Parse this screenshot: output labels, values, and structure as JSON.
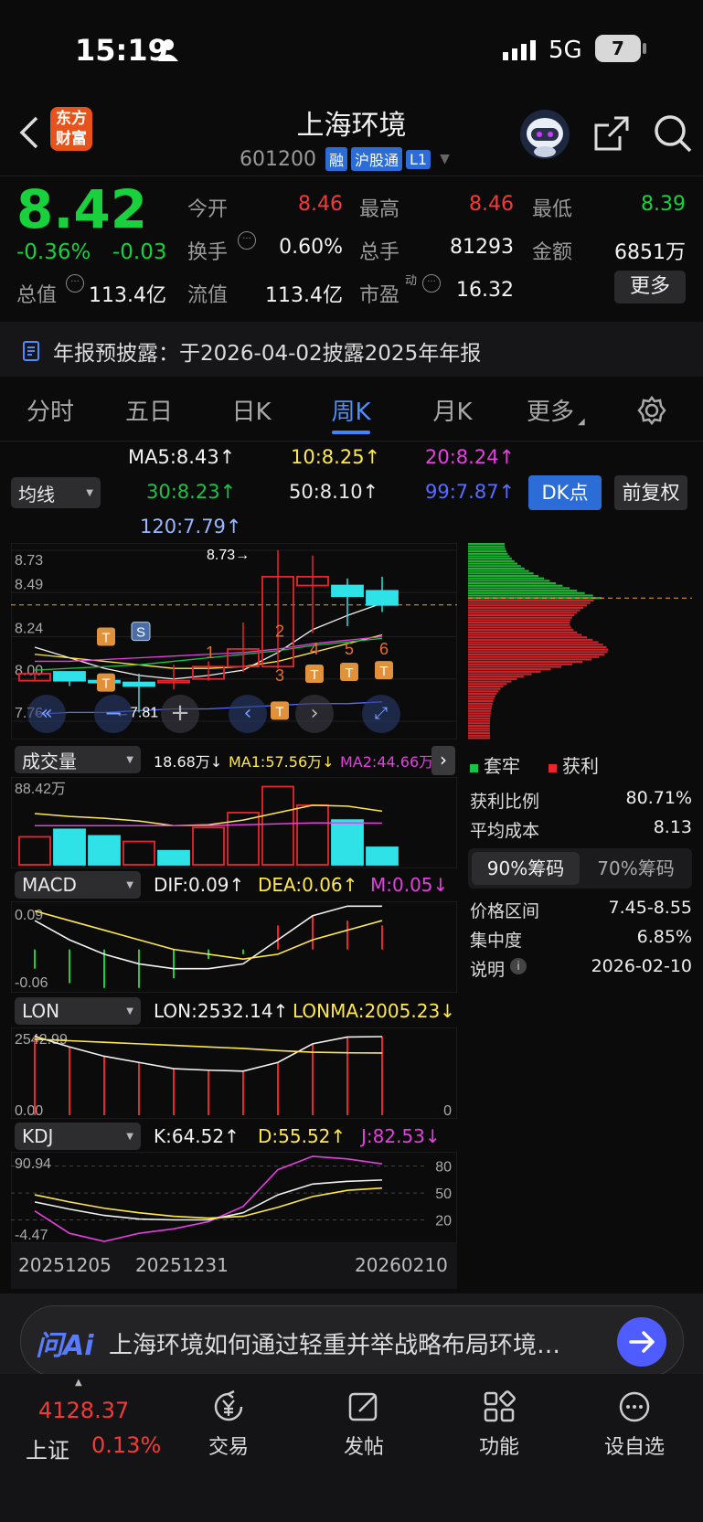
{
  "status_bar": {
    "time": "15:19",
    "network": "5G",
    "battery": "7"
  },
  "header": {
    "logo_text": "东方\n财富",
    "title": "上海环境",
    "code": "601200",
    "badges": [
      "融",
      "沪股通",
      "L1"
    ]
  },
  "quote": {
    "price": "8.42",
    "change_pct": "-0.36%",
    "change": "-0.03",
    "fields": [
      {
        "label": "今开",
        "value": "8.46",
        "color": "red"
      },
      {
        "label": "最高",
        "value": "8.46",
        "color": "red"
      },
      {
        "label": "最低",
        "value": "8.39",
        "color": "green"
      },
      {
        "label": "换手",
        "value": "0.60%",
        "color": "white"
      },
      {
        "label": "总手",
        "value": "81293",
        "color": "white"
      },
      {
        "label": "金额",
        "value": "6851万",
        "color": "white"
      },
      {
        "label": "总值",
        "value": "113.4亿",
        "color": "white"
      },
      {
        "label": "流值",
        "value": "113.4亿",
        "color": "white"
      },
      {
        "label": "市盈",
        "value": "16.32",
        "color": "white"
      }
    ],
    "dyn_sup": "动",
    "more_button": "更多"
  },
  "notice": {
    "text": "年报预披露：于2026-04-02披露2025年年报"
  },
  "period_tabs": [
    "分时",
    "五日",
    "日K",
    "周K",
    "月K",
    "更多"
  ],
  "active_tab": "周K",
  "ma": {
    "selector": "均线",
    "items": [
      {
        "text": "MA5:8.43↑",
        "color": "#f2f2f2"
      },
      {
        "text": "10:8.25↑",
        "color": "#ffe94a"
      },
      {
        "text": "20:8.24↑",
        "color": "#e53fe0"
      },
      {
        "text": "30:8.23↑",
        "color": "#19c34a"
      },
      {
        "text": "50:8.10↑",
        "color": "#e8e8e8"
      },
      {
        "text": "99:7.87↑",
        "color": "#5a6cff"
      },
      {
        "text": "120:7.79↑",
        "color": "#9ab7ff"
      }
    ],
    "dk_button": "DK点",
    "adjust_button": "前复权"
  },
  "chart_data": [
    {
      "type": "candlestick",
      "ylim": [
        7.76,
        8.73
      ],
      "y_ticks": [
        "8.73",
        "8.49",
        "8.24",
        "8.00",
        "7.76"
      ],
      "high_label": "8.73→",
      "low_label": "←7.81",
      "candles": [
        {
          "o": 7.99,
          "c": 8.03,
          "h": 8.03,
          "l": 7.99,
          "dir": "up"
        },
        {
          "o": 8.04,
          "c": 7.99,
          "h": 8.04,
          "l": 7.96,
          "dir": "down"
        },
        {
          "o": 7.98,
          "c": 7.99,
          "h": 8.03,
          "l": 7.97,
          "dir": "down"
        },
        {
          "o": 7.96,
          "c": 7.98,
          "h": 8.03,
          "l": 7.81,
          "dir": "down"
        },
        {
          "o": 7.98,
          "c": 7.99,
          "h": 8.08,
          "l": 7.94,
          "dir": "up"
        },
        {
          "o": 8.0,
          "c": 8.07,
          "h": 8.1,
          "l": 7.99,
          "dir": "up"
        },
        {
          "o": 8.07,
          "c": 8.17,
          "h": 8.32,
          "l": 8.04,
          "dir": "up"
        },
        {
          "o": 8.07,
          "c": 8.58,
          "h": 8.73,
          "l": 8.06,
          "dir": "up"
        },
        {
          "o": 8.53,
          "c": 8.58,
          "h": 8.7,
          "l": 8.26,
          "dir": "up"
        },
        {
          "o": 8.53,
          "c": 8.47,
          "h": 8.57,
          "l": 8.3,
          "dir": "down"
        },
        {
          "o": 8.5,
          "c": 8.42,
          "h": 8.58,
          "l": 8.38,
          "dir": "down"
        }
      ],
      "markers": [
        "T",
        "S",
        "T",
        "1",
        "2",
        "3",
        "4",
        "5",
        "6",
        "T",
        "T",
        "T",
        "T"
      ],
      "current_price": 8.42
    },
    {
      "type": "bar",
      "name": "成交量",
      "header": [
        "18.68万↓",
        "MA1:57.56万↓",
        "MA2:44.66万↓"
      ],
      "ymax_label": "88.42万",
      "values": [
        30,
        38,
        31,
        25,
        15,
        40,
        56,
        84,
        64,
        48,
        18.68
      ],
      "dir": [
        "up",
        "cyan",
        "cyan",
        "up",
        "cyan",
        "up",
        "up",
        "up",
        "up",
        "cyan",
        "cyan"
      ],
      "ma1": [
        55,
        52,
        50,
        47,
        42,
        43,
        48,
        56,
        64,
        63,
        57.56
      ],
      "ma2": [
        42,
        42,
        42,
        42,
        42,
        42,
        43,
        44,
        45,
        45,
        44.66
      ]
    },
    {
      "type": "line",
      "name": "MACD",
      "header": [
        "DIF:0.09↑",
        "DEA:0.06↑",
        "M:0.05↓"
      ],
      "y_ticks": [
        "0.09",
        "-0.06"
      ],
      "dif": [
        0.06,
        0.02,
        -0.01,
        -0.03,
        -0.04,
        -0.04,
        -0.03,
        0.02,
        0.07,
        0.09,
        0.09
      ],
      "dea": [
        0.08,
        0.06,
        0.04,
        0.02,
        0.0,
        -0.01,
        -0.02,
        -0.01,
        0.02,
        0.04,
        0.06
      ],
      "m": [
        -0.04,
        -0.07,
        -0.08,
        -0.08,
        -0.06,
        -0.02,
        -0.01,
        0.05,
        0.07,
        0.06,
        0.05
      ]
    },
    {
      "type": "line",
      "name": "LON",
      "header": [
        "LON:2532.14↑",
        "LONMA:2005.23↓"
      ],
      "y_ticks": [
        "2542.99",
        "0.00"
      ],
      "right_label": "0",
      "lon": [
        2542,
        2200,
        1900,
        1700,
        1500,
        1450,
        1420,
        1700,
        2300,
        2520,
        2532.14
      ],
      "lonma": [
        2450,
        2400,
        2350,
        2300,
        2250,
        2200,
        2150,
        2080,
        2030,
        2010,
        2005.23
      ]
    },
    {
      "type": "line",
      "name": "KDJ",
      "header": [
        "K:64.52↑",
        "D:55.52↑",
        "J:82.53↓"
      ],
      "y_ticks": [
        "90.94",
        "-4.47"
      ],
      "right_ticks": [
        "80",
        "50",
        "20"
      ],
      "x_ticks": [
        "20251205",
        "20251231",
        "20260210"
      ],
      "k": [
        40,
        32,
        25,
        21,
        20,
        20,
        28,
        48,
        60,
        63,
        64.52
      ],
      "d": [
        48,
        40,
        33,
        28,
        24,
        22,
        24,
        34,
        46,
        53,
        55.52
      ],
      "j": [
        30,
        5,
        -4,
        5,
        10,
        18,
        35,
        76,
        91,
        88,
        82.53
      ]
    }
  ],
  "chips": {
    "legend": [
      "套牢",
      "获利"
    ],
    "rows": [
      {
        "label": "获利比例",
        "value": "80.71%"
      },
      {
        "label": "平均成本",
        "value": "8.13"
      }
    ],
    "tabs": [
      "90%筹码",
      "70%筹码"
    ],
    "rows2": [
      {
        "label": "价格区间",
        "value": "7.45-8.55"
      },
      {
        "label": "集中度",
        "value": "6.85%"
      },
      {
        "label": "说明",
        "value": "2026-02-10"
      }
    ]
  },
  "ai_bar": {
    "brand": "问Ai",
    "text": "上海环境如何通过轻重并举战略布局环境…"
  },
  "bottom_nav": {
    "index_value": "4128.37",
    "index_name": "上证",
    "index_change": "0.13%",
    "items": [
      {
        "label": "交易",
        "icon": "yen-exchange-icon"
      },
      {
        "label": "发帖",
        "icon": "edit-post-icon"
      },
      {
        "label": "功能",
        "icon": "grid-apps-icon"
      },
      {
        "label": "设自选",
        "icon": "more-circle-icon"
      }
    ]
  },
  "colors": {
    "up": "#e8262b",
    "down": "#2ee2e8",
    "green": "#19d13c",
    "accent": "#2b6cd6"
  }
}
